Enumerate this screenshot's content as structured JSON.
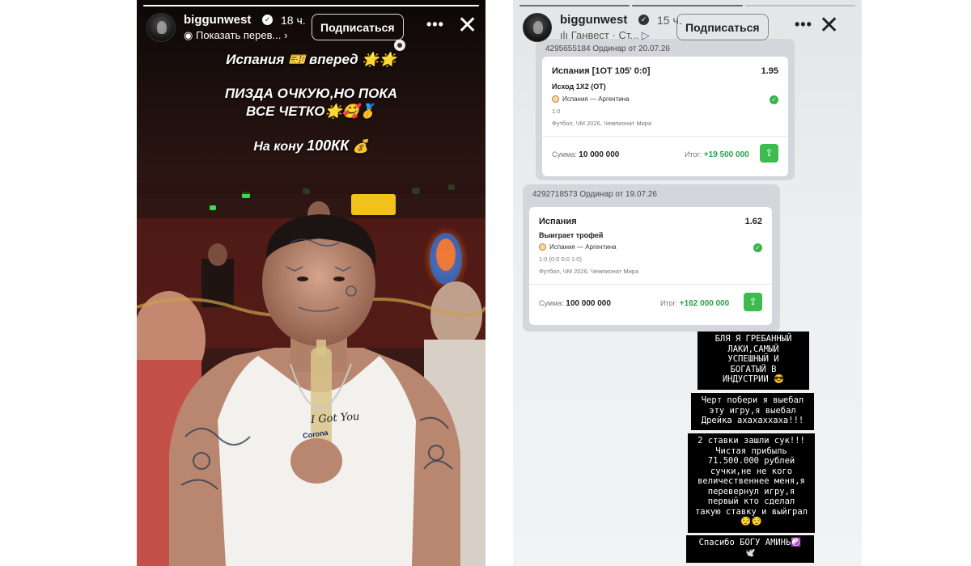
{
  "stories": [
    {
      "username": "biggunwest",
      "time": "18 ч.",
      "subtitle": "Показать перев...",
      "follow_label": "Подписаться",
      "more_label": "•••",
      "close_label": "✕",
      "captions": {
        "line1": "Испания 🎫 вперед 🌟🌟",
        "line2": "ПИЗДА ОЧКУЮ,НО ПОКА",
        "line3": "ВСЕ ЧЕТКО🌟🥰🥇",
        "line4_prefix": "На кону ",
        "line4_bold": "100КК",
        "line4_suffix": " 💰"
      },
      "shirt_text": "I Got You",
      "bottle_label": "Corona"
    },
    {
      "username": "biggunwest",
      "time": "15 ч.",
      "subtitle": "ılı Ганвест · Ст... ▷",
      "follow_label": "Подписаться",
      "more_label": "•••",
      "close_label": "✕",
      "bets": [
        {
          "id_line": "4295655184  Ординар от 20.07.26",
          "title": "Испания [1ОТ 105' 0:0]",
          "odds": "1.95",
          "market": "Исход 1X2 (ОТ)",
          "match": "Испания — Аргентина",
          "score": "1:0",
          "league": "Футбол, ЧМ 2026, Чемпионат Мира",
          "amount_label": "Сумма:",
          "amount": "10 000 000",
          "result_label": "Итог:",
          "result": "+19 500 000"
        },
        {
          "id_line": "4292718573  Ординар от 19.07.26",
          "title": "Испания",
          "odds": "1.62",
          "market": "Выиграет трофей",
          "match": "Испания — Аргентина",
          "score": "1:0 (0:0 0:0 1:0)",
          "league": "Футбол, ЧМ 2026, Чемпионат Мира",
          "amount_label": "Сумма:",
          "amount": "100 000 000",
          "result_label": "Итог:",
          "result": "+162 000 000"
        }
      ],
      "messages": [
        "БЛЯ Я ГРЕБАННЫЙ\nЛАКИ,САМЫЙ\nУСПЕШНЫЙ И\nБОГАТЫЙ В\nИНДУСТРИИ 😎",
        "Черт побери я выебал\nэту игру,я выебал\nДрейка ахахаххаха!!!",
        "2 ставки зашли сук!!!\nЧистая прибыль\n71.500.000 рублей\nсучки,не не кого\nвеличественнее меня,я\nперевернул игру,я\nпервый кто сделал\nтакую ставку и выйграл\n😌😌",
        "Спасибо БОГУ АМИНЬ☯️\n🕊️"
      ]
    }
  ],
  "colors": {
    "win_green": "#2aa14b",
    "share_green": "#3dbb4f",
    "text_box_bg": "#000000"
  }
}
